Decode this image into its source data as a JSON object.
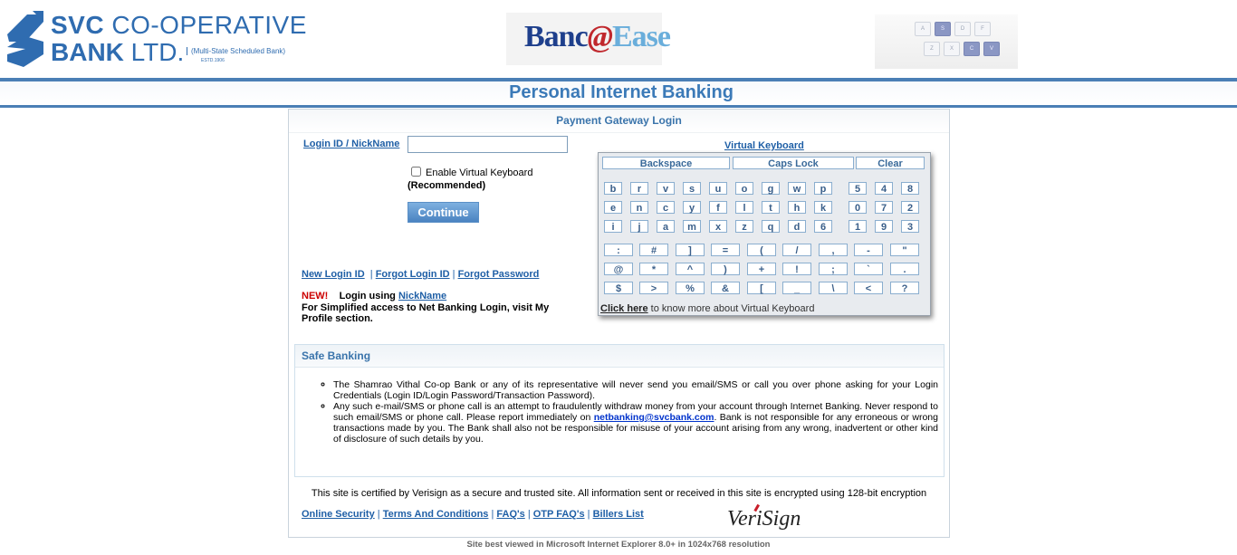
{
  "header": {
    "logo_line1_bold": "SVC",
    "logo_line1_rest": "CO-OPERATIVE",
    "logo_line2_bold": "BANK",
    "logo_line2_rest": "LTD.",
    "logo_subtitle": "(Multi-State Scheduled Bank)",
    "logo_estd": "ESTD.1906",
    "brand_banc": "Banc",
    "brand_at": "@",
    "brand_ease": "Ease",
    "key_image_letters": [
      "A",
      "S",
      "D",
      "F",
      "Z",
      "X",
      "C",
      "V"
    ]
  },
  "page_title": "Personal Internet Banking",
  "gateway": {
    "title": "Payment Gateway Login",
    "login_label": "Login ID / NickName",
    "login_value": "",
    "vk_checkbox_label": "Enable Virtual Keyboard",
    "recommended": "(Recommended)",
    "continue_label": "Continue",
    "link_new_login": "New Login ID",
    "link_forgot_login": "Forgot Login ID",
    "link_forgot_password": "Forgot Password",
    "new_badge": "NEW!",
    "login_using": "Login using",
    "nickname_link": "NickName",
    "simplified_text": "For Simplified access to Net Banking Login, visit My Profile section."
  },
  "virtual_keyboard": {
    "title": "Virtual Keyboard",
    "backspace": "Backspace",
    "caps_lock": "Caps Lock",
    "clear": "Clear",
    "letter_rows": [
      [
        "b",
        "r",
        "v",
        "s",
        "u",
        "o",
        "g",
        "w",
        "p"
      ],
      [
        "e",
        "n",
        "c",
        "y",
        "f",
        "l",
        "t",
        "h",
        "k"
      ],
      [
        "i",
        "j",
        "a",
        "m",
        "x",
        "z",
        "q",
        "d",
        "6"
      ]
    ],
    "digit_rows": [
      [
        "5",
        "4",
        "8"
      ],
      [
        "0",
        "7",
        "2"
      ],
      [
        "1",
        "9",
        "3"
      ]
    ],
    "symbol_rows": [
      [
        ":",
        "#",
        "]",
        "=",
        "(",
        "/",
        ",",
        "-",
        "\""
      ],
      [
        "@",
        "*",
        "^",
        ")",
        "+",
        "!",
        ";",
        "`",
        "."
      ],
      [
        "$",
        ">",
        "%",
        "&",
        "[",
        "_",
        "\\",
        "<",
        "?"
      ]
    ],
    "footer_link": "Click here",
    "footer_text": " to know more about Virtual Keyboard"
  },
  "safe_banking": {
    "title": "Safe Banking",
    "item1": "The Shamrao Vithal Co-op Bank or any of its representative will never send you email/SMS or call you over phone asking for your Login Credentials (Login ID/Login Password/Transaction Password).",
    "item2_before": "Any such e-mail/SMS or phone call is an attempt to fraudulently withdraw money from your account through Internet Banking. Never respond to such email/SMS or phone call. Please report immediately on ",
    "item2_email": "netbanking@svcbank.com",
    "item2_after": ". Bank is not responsible for any erroneous or wrong transactions made by you. The Bank shall also not be responsible for misuse of your account arising from any wrong, inadvertent or other kind of disclosure of such details by you."
  },
  "verisign": {
    "statement": "This site is certified by Verisign as a secure and trusted site. All information sent or received in this site is encrypted using 128-bit encryption",
    "logo_text": "VeriSign"
  },
  "bottom_links": [
    "Online Security",
    "Terms And Conditions",
    "FAQ's",
    "OTP FAQ's",
    "Billers List"
  ],
  "footer_note": "Site best viewed in Microsoft Internet Explorer 8.0+ in 1024x768 resolution"
}
